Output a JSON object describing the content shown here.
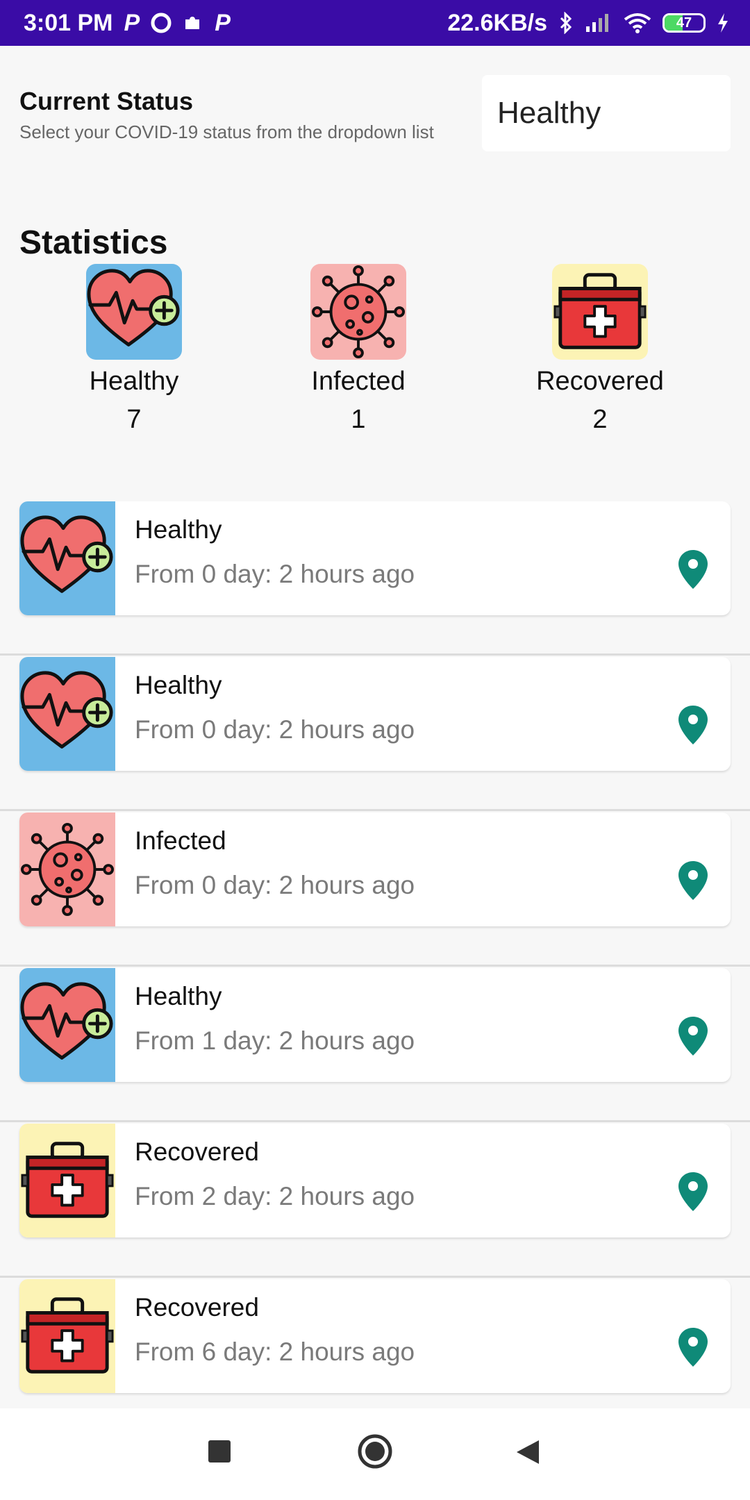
{
  "status_bar": {
    "time": "3:01 PM",
    "network_speed": "22.6KB/s",
    "battery_level": "47",
    "notification_icons": [
      "p-icon",
      "opera-icon",
      "puzzle-icon",
      "p-icon"
    ]
  },
  "current_status": {
    "title": "Current Status",
    "subtitle": "Select your COVID-19 status from the dropdown list",
    "selected": "Healthy"
  },
  "statistics": {
    "title": "Statistics",
    "items": [
      {
        "label": "Healthy",
        "count": "7",
        "icon": "heart-plus-icon",
        "color": "#6cb8e6"
      },
      {
        "label": "Infected",
        "count": "1",
        "icon": "virus-icon",
        "color": "#f7b2b0"
      },
      {
        "label": "Recovered",
        "count": "2",
        "icon": "first-aid-kit-icon",
        "color": "#fcf3b5"
      }
    ]
  },
  "history": [
    {
      "status": "Healthy",
      "time": "From 0 day: 2 hours ago",
      "icon": "heart-plus-icon"
    },
    {
      "status": "Healthy",
      "time": "From 0 day: 2 hours ago",
      "icon": "heart-plus-icon"
    },
    {
      "status": "Infected",
      "time": "From 0 day: 2 hours ago",
      "icon": "virus-icon"
    },
    {
      "status": "Healthy",
      "time": "From 1 day: 2 hours ago",
      "icon": "heart-plus-icon"
    },
    {
      "status": "Recovered",
      "time": "From 2 day: 2 hours ago",
      "icon": "first-aid-kit-icon"
    },
    {
      "status": "Recovered",
      "time": "From 6 day: 2 hours ago",
      "icon": "first-aid-kit-icon"
    }
  ],
  "colors": {
    "status_bar": "#3a0ca6",
    "pin": "#0f8a78",
    "healthy_bg": "#6cb8e6",
    "infected_bg": "#f7b2b0",
    "recovered_bg": "#fcf3b5"
  },
  "nav": [
    "recents-button",
    "home-button",
    "back-button"
  ]
}
